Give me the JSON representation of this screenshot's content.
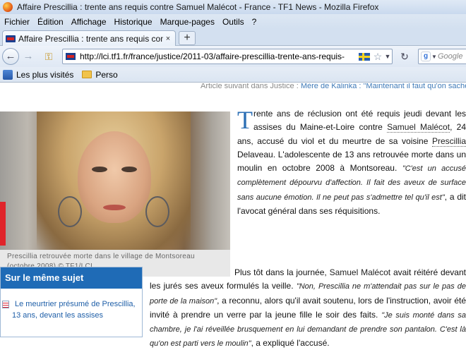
{
  "window": {
    "title": "Affaire Prescillia : trente ans requis contre Samuel Malécot - France - TF1 News - Mozilla Firefox"
  },
  "menu": {
    "items": [
      {
        "label": "Fichier"
      },
      {
        "label": "Édition"
      },
      {
        "label": "Affichage"
      },
      {
        "label": "Historique"
      },
      {
        "label": "Marque-pages"
      },
      {
        "label": "Outils"
      },
      {
        "label": "?"
      }
    ]
  },
  "tabs": {
    "active_label": "Affaire Prescillia : trente ans requis contr...",
    "close_glyph": "×",
    "new_tab_glyph": "+"
  },
  "navbar": {
    "url": "http://lci.tf1.fr/france/justice/2011-03/affaire-prescillia-trente-ans-requis-",
    "search_placeholder": "Google"
  },
  "bookmarks": {
    "items": [
      {
        "label": "Les plus visités"
      },
      {
        "label": "Perso"
      }
    ]
  },
  "article": {
    "prev_line": {
      "prefix": "Article suivant dans Justice :",
      "link1": "Mère de Kalinka :",
      "link2": "\"Maintenant il faut qu'on sache\""
    },
    "photo_caption": "Prescillia retrouvée morte dans le village de Montsoreau (octobre 2008) © TF1/LCI",
    "p1": {
      "dropcap": "T",
      "t1": "rente ans de réclusion ont été requis jeudi devant les assises du Maine-et-Loire contre ",
      "link_samuel": "Samuel Malécot",
      "t2": ", 24 ans, accusé du viol et du meurtre de sa voisine ",
      "link_prescillia": "Prescillia",
      "t3": " Delaveau. L'adolescente de 13 ans retrouvée morte dans un moulin en octobre 2008 à Montsoreau. ",
      "quote": "\"C'est un accusé complètement dépourvu d'affection. Il fait des aveux de surface sans aucune émotion. Il ne peut pas s'admettre tel qu'il est\"",
      "t4": ", a dit l'avocat général dans ses réquisitions."
    },
    "related": {
      "heading": "Sur le même sujet",
      "link": "Le meurtrier présumé de Prescillia, 13 ans, devant les assises"
    },
    "p2": {
      "t1": "Plus tôt dans la journée, ",
      "author": "Samuel Malécot",
      "t2": " avait réitéré devant les jurés ses aveux formulés la veille. ",
      "quote1": "\"Non, Prescillia ne m'attendait pas sur le pas de porte de la maison\"",
      "t3": ", a reconnu, alors qu'il avait soutenu, lors de l'instruction, avoir été invité à prendre un verre par la jeune fille le soir des faits. ",
      "quote2": "\"Je suis monté dans sa chambre, je l'ai réveillée brusquement en lui demandant de prendre son pantalon. C'est là qu'on est parti vers le moulin\"",
      "t4": ", a expliqué l'accusé."
    }
  }
}
